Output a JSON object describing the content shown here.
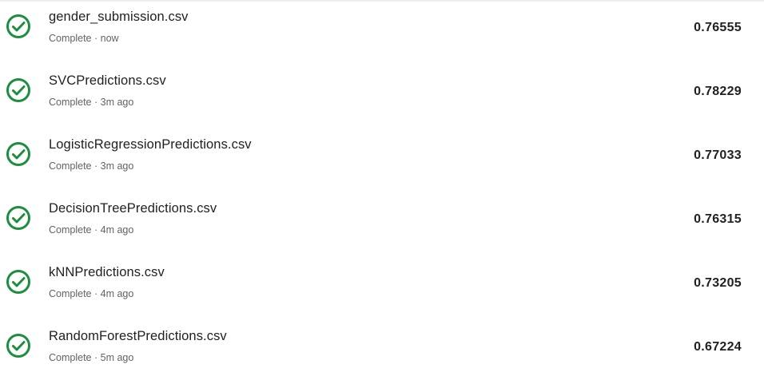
{
  "accent_color": "#1e8e3e",
  "submissions": [
    {
      "icon": "check-circle-icon",
      "file_name": "gender_submission.csv",
      "status": "Complete",
      "separator": "·",
      "time": "now",
      "score": "0.76555"
    },
    {
      "icon": "check-circle-icon",
      "file_name": "SVCPredictions.csv",
      "status": "Complete",
      "separator": "·",
      "time": "3m ago",
      "score": "0.78229"
    },
    {
      "icon": "check-circle-icon",
      "file_name": "LogisticRegressionPredictions.csv",
      "status": "Complete",
      "separator": "·",
      "time": "3m ago",
      "score": "0.77033"
    },
    {
      "icon": "check-circle-icon",
      "file_name": "DecisionTreePredictions.csv",
      "status": "Complete",
      "separator": "·",
      "time": "4m ago",
      "score": "0.76315"
    },
    {
      "icon": "check-circle-icon",
      "file_name": "kNNPredictions.csv",
      "status": "Complete",
      "separator": "·",
      "time": "4m ago",
      "score": "0.73205"
    },
    {
      "icon": "check-circle-icon",
      "file_name": "RandomForestPredictions.csv",
      "status": "Complete",
      "separator": "·",
      "time": "5m ago",
      "score": "0.67224"
    }
  ]
}
